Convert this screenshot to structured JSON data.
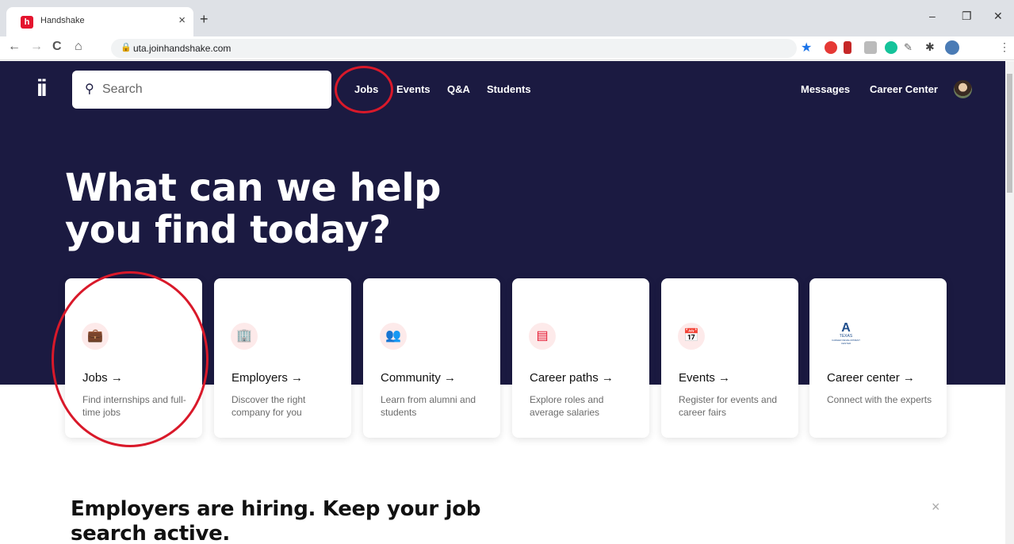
{
  "browser": {
    "tab_title": "Handshake",
    "tab_favicon": "h",
    "tab_close": "×",
    "new_tab": "+",
    "url": "uta.joinhandshake.com",
    "nav": {
      "back": "←",
      "forward": "→",
      "reload": "C",
      "home": "⌂"
    },
    "window_controls": {
      "minimize": "–",
      "restore": "❐",
      "close": "✕"
    }
  },
  "header": {
    "logo": "ii",
    "search": {
      "placeholder": "Search"
    },
    "nav": [
      {
        "label": "Jobs"
      },
      {
        "label": "Events"
      },
      {
        "label": "Q&A"
      },
      {
        "label": "Students"
      }
    ],
    "right": [
      {
        "label": "Messages"
      },
      {
        "label": "Career Center"
      }
    ]
  },
  "hero": {
    "title_line1": "What can we help",
    "title_line2": "you find today?"
  },
  "cards": [
    {
      "icon": "briefcase-icon",
      "glyph": "💼",
      "title": "Jobs →",
      "desc": "Find internships and full-time jobs"
    },
    {
      "icon": "building-icon",
      "glyph": "🏢",
      "title": "Employers →",
      "desc": "Discover the right company for you"
    },
    {
      "icon": "people-icon",
      "glyph": "👥",
      "title": "Community →",
      "desc": "Learn from alumni and students"
    },
    {
      "icon": "career-path-icon",
      "glyph": "▤",
      "title": "Career paths →",
      "desc": "Explore roles and average salaries"
    },
    {
      "icon": "calendar-icon",
      "glyph": "📅",
      "title": "Events →",
      "desc": "Register for events and career fairs"
    },
    {
      "icon": "uta-crest-icon",
      "glyph": "A",
      "title": "Career center →",
      "desc": "Connect with the experts"
    }
  ],
  "banner": {
    "line1": "Employers are hiring. Keep your job",
    "line2": "search active.",
    "close": "×"
  },
  "colors": {
    "navy": "#1b1a41",
    "accent": "#e4142e",
    "annotation": "#d9192a"
  }
}
